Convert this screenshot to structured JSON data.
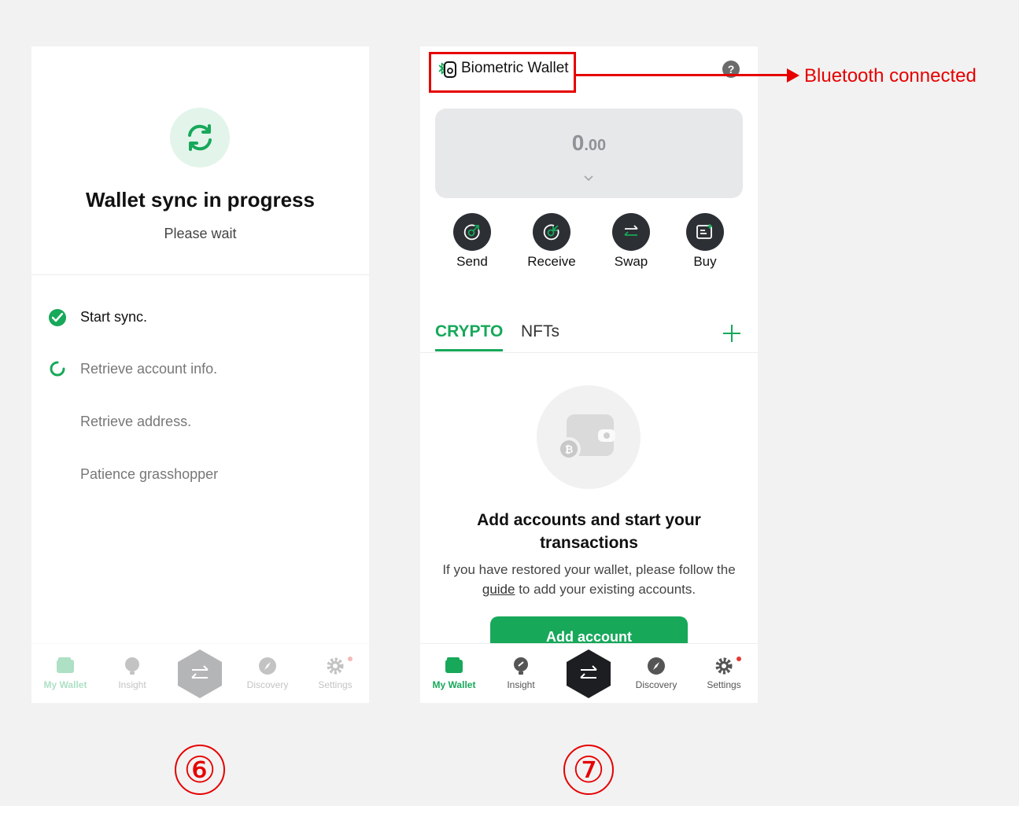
{
  "screen6": {
    "title": "Wallet sync in progress",
    "subtitle": "Please wait",
    "steps": [
      {
        "label": "Start sync.",
        "status": "done"
      },
      {
        "label": "Retrieve account info.",
        "status": "in-progress"
      },
      {
        "label": "Retrieve address.",
        "status": "pending"
      },
      {
        "label": "Patience grasshopper",
        "status": "pending"
      }
    ],
    "marker": "⑥"
  },
  "screen7": {
    "wallet_name": "Biometric Wallet",
    "help": "?",
    "balance_int": "0",
    "balance_dec": ".00",
    "actions": [
      {
        "label": "Send",
        "icon": "send-icon"
      },
      {
        "label": "Receive",
        "icon": "receive-icon"
      },
      {
        "label": "Swap",
        "icon": "swap-icon"
      },
      {
        "label": "Buy",
        "icon": "buy-icon"
      }
    ],
    "tabs": {
      "crypto": "CRYPTO",
      "nfts": "NFTs"
    },
    "empty": {
      "title": "Add accounts and start your transactions",
      "desc_before": "If you have restored your wallet, please follow the ",
      "desc_link": "guide",
      "desc_after": " to add your existing accounts.",
      "button": "Add account"
    },
    "marker": "⑦"
  },
  "tabbar": {
    "items": [
      {
        "label": "My Wallet",
        "icon": "wallet-icon",
        "active": true
      },
      {
        "label": "Insight",
        "icon": "insight-icon"
      },
      {
        "label": "Discovery",
        "icon": "compass-icon"
      },
      {
        "label": "Settings",
        "icon": "gear-icon",
        "badge": true
      }
    ]
  },
  "annotation": {
    "text": "Bluetooth connected"
  },
  "colors": {
    "accent": "#17a85a",
    "annotation": "#e60000",
    "dark_button": "#2c2f33",
    "card": "#e7e8ea"
  }
}
